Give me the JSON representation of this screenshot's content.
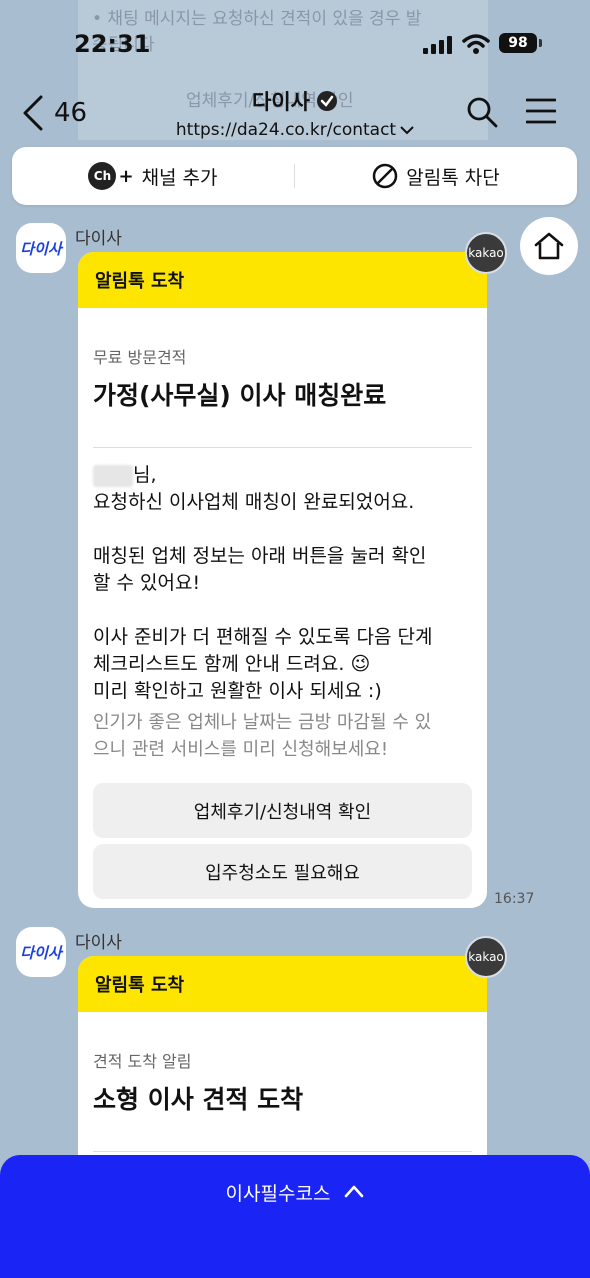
{
  "ghost": {
    "line1": "• 채팅 메시지는 요청하신 견적이 있을 경우 발",
    "line2": "송됩니다",
    "line3": "업체후기/신청내역 확인"
  },
  "status": {
    "time": "22:31",
    "battery": "98"
  },
  "nav": {
    "back_count": "46",
    "title": "다이사",
    "url": "https://da24.co.kr/contact"
  },
  "channel_bar": {
    "add_label": "채널 추가",
    "block_label": "알림톡 차단",
    "ch_icon_text": "Ch"
  },
  "messages": [
    {
      "sender": "다이사",
      "avatar_text": "다이사",
      "kakao": "kakao",
      "header": "알림톡 도착",
      "subtitle": "무료 방문견적",
      "title": "가정(사무실) 이사 매칭완료",
      "name_suffix": "님,",
      "p1": "요청하신 이사업체 매칭이 완료되었어요.",
      "p2a": "매칭된 업체 정보는 아래 버튼을 눌러 확인",
      "p2b": "할 수 있어요!",
      "p3a": "이사 준비가 더 편해질 수 있도록 다음 단계",
      "p3b": "체크리스트도 함께 안내 드려요. 😉",
      "p3c": "미리 확인하고 원활한 이사 되세요 :)",
      "note_a": "인기가 좋은 업체나 날짜는 금방 마감될 수 있",
      "note_b": "으니 관련 서비스를 미리 신청해보세요!",
      "button1": "업체후기/신청내역 확인",
      "button2": "입주청소도 필요해요",
      "time": "16:37"
    },
    {
      "sender": "다이사",
      "avatar_text": "다이사",
      "kakao": "kakao",
      "header": "알림톡 도착",
      "subtitle": "견적 도착 알림",
      "title": "소형 이사 견적 도착"
    }
  ],
  "bottom_bar": {
    "label": "이사필수코스"
  },
  "colors": {
    "brand_blue": "#1a24f5",
    "kakao_yellow": "#fee500",
    "background": "#a9bdd0"
  }
}
